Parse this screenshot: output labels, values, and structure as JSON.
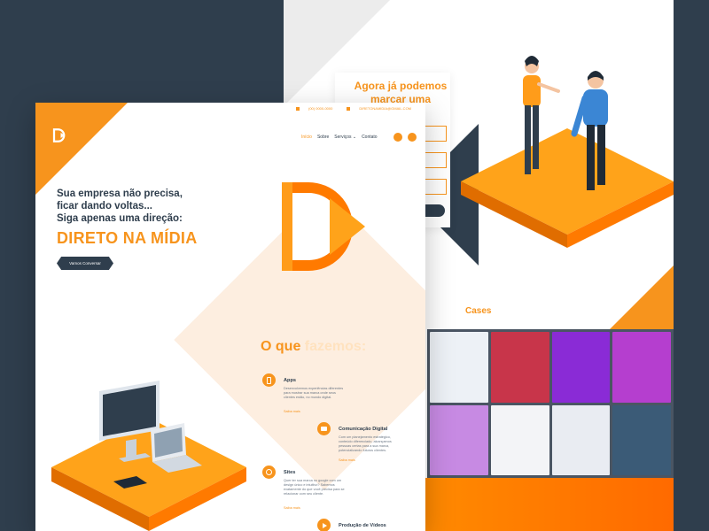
{
  "hero": {
    "line1": "Sua empresa não precisa,",
    "line2": "ficar dando voltas...",
    "line3": "Siga apenas uma direção:",
    "accent": "DIRETO NA MÍDIA",
    "cta_label": "Vamos Conversar"
  },
  "topbar": {
    "phone": "(00) 0000-0000",
    "email": "DIRETONAMIDIA@GMAIL.COM"
  },
  "nav": {
    "items": [
      {
        "label": "Início"
      },
      {
        "label": "Sobre"
      },
      {
        "label": "Serviços ⌄"
      },
      {
        "label": "Contato"
      }
    ]
  },
  "services": {
    "title_main": "O que",
    "title_ghost": "fazemos:",
    "items": [
      {
        "title": "Apps",
        "desc": "Desenvolvemos experiências diferentes para mostrar sua marca onde seus clientes estão, no mundo digital.",
        "link": "Saiba mais"
      },
      {
        "title": "Comunicação Digital",
        "desc": "Com um planejamento estratégico, conteúdo diferenciado, alcançamos pessoas certas para a sua marca, potencializando futuros clientes.",
        "link": "Saiba mais"
      },
      {
        "title": "Sites",
        "desc": "Quer ter sua marca no google com um design único e intuitivo? Sabemos exatamente do que você precisa para se relacionar com seu cliente.",
        "link": "Saiba mais"
      },
      {
        "title": "Produção de Vídeos",
        "desc": "",
        "link": ""
      }
    ]
  },
  "contact": {
    "title": "Agora já podemos marcar uma conversa,"
  },
  "cases": {
    "title": "Cases",
    "tiles": [
      {
        "color": "#edf1f6"
      },
      {
        "color": "#c8354a"
      },
      {
        "color": "#8a2bd6"
      },
      {
        "color": "#b53ecf"
      },
      {
        "color": "#c78ae3"
      },
      {
        "color": "#f3f4f7"
      },
      {
        "color": "#e9ecf2"
      },
      {
        "color": "#3b5b77"
      }
    ]
  },
  "colors": {
    "accent": "#f7941d",
    "dark": "#2f3e4d",
    "soft": "#fdeee0"
  }
}
